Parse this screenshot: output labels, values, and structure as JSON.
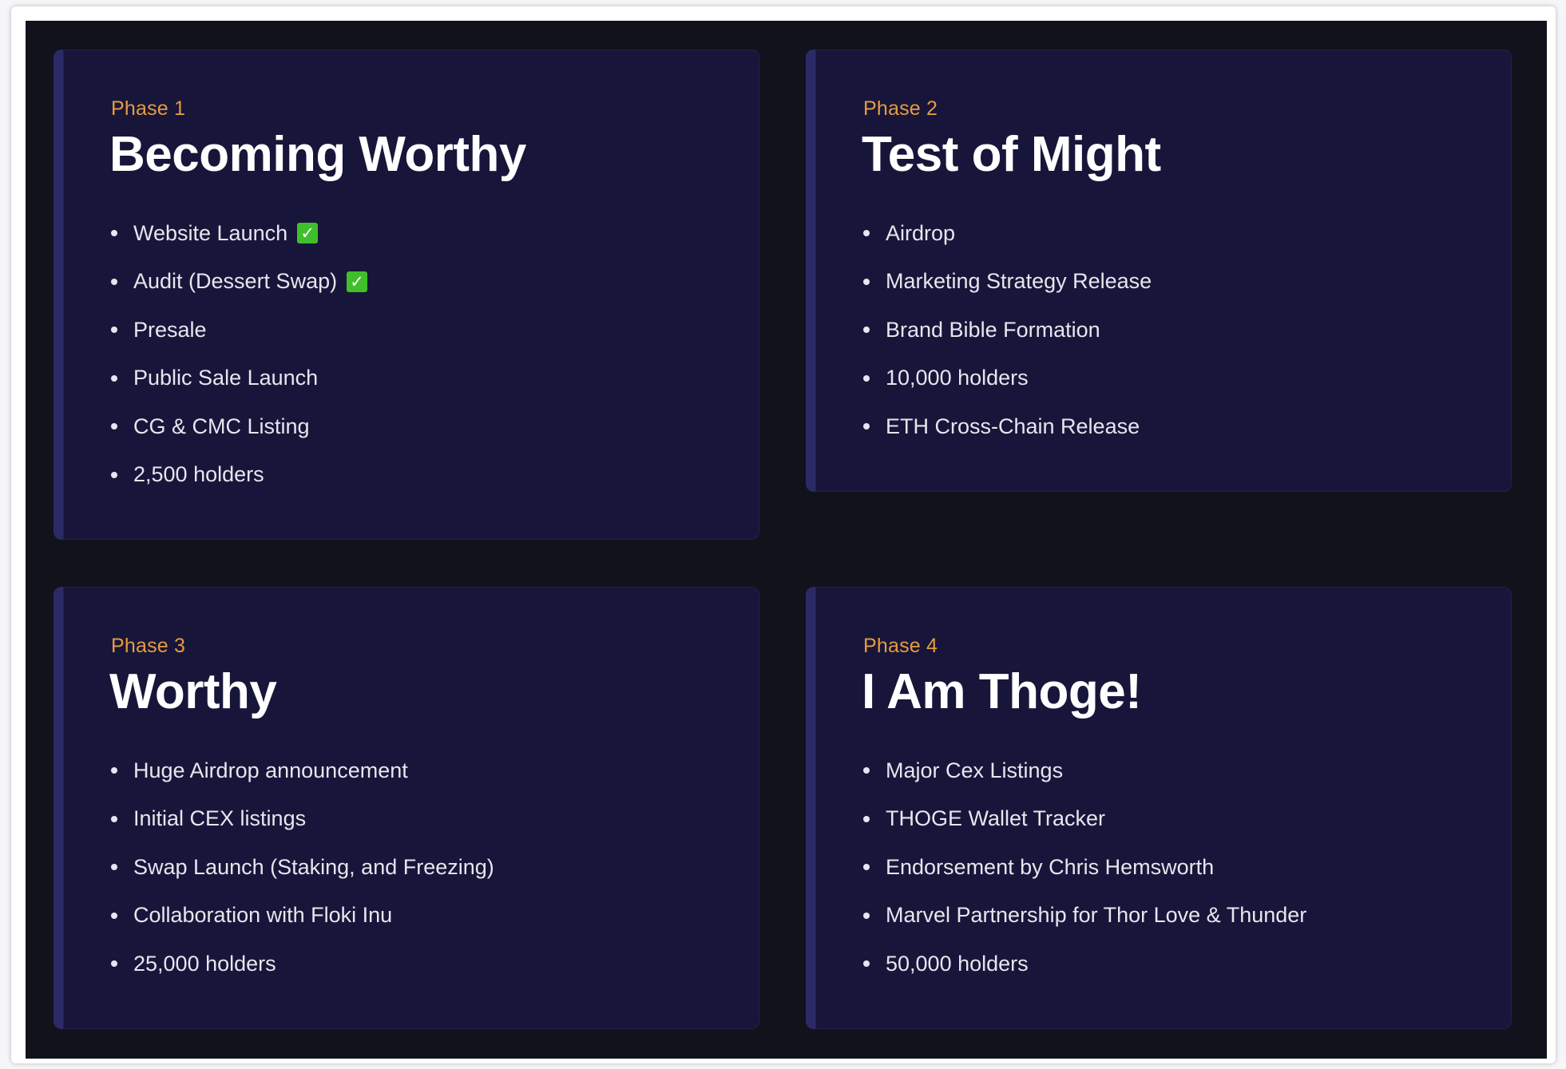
{
  "phases": [
    {
      "label": "Phase 1",
      "title": "Becoming Worthy",
      "items": [
        {
          "text": "Website Launch",
          "done": true
        },
        {
          "text": "Audit (Dessert Swap)",
          "done": true
        },
        {
          "text": "Presale",
          "done": false
        },
        {
          "text": "Public Sale Launch",
          "done": false
        },
        {
          "text": "CG & CMC Listing",
          "done": false
        },
        {
          "text": "2,500 holders",
          "done": false
        }
      ]
    },
    {
      "label": "Phase 2",
      "title": "Test of Might",
      "items": [
        {
          "text": "Airdrop",
          "done": false
        },
        {
          "text": "Marketing Strategy Release",
          "done": false
        },
        {
          "text": "Brand Bible Formation",
          "done": false
        },
        {
          "text": "10,000 holders",
          "done": false
        },
        {
          "text": "ETH Cross-Chain Release",
          "done": false
        }
      ]
    },
    {
      "label": "Phase 3",
      "title": "Worthy",
      "items": [
        {
          "text": "Huge Airdrop announcement",
          "done": false
        },
        {
          "text": "Initial CEX listings",
          "done": false
        },
        {
          "text": "Swap Launch (Staking, and Freezing)",
          "done": false
        },
        {
          "text": "Collaboration with Floki Inu",
          "done": false
        },
        {
          "text": "25,000 holders",
          "done": false
        }
      ]
    },
    {
      "label": "Phase 4",
      "title": "I Am Thoge!",
      "items": [
        {
          "text": "Major Cex Listings",
          "done": false
        },
        {
          "text": "THOGE Wallet Tracker",
          "done": false
        },
        {
          "text": "Endorsement by Chris Hemsworth",
          "done": false
        },
        {
          "text": "Marvel Partnership for Thor Love & Thunder",
          "done": false
        },
        {
          "text": "50,000 holders",
          "done": false
        }
      ]
    }
  ],
  "check_glyph": "✓",
  "colors": {
    "background": "#12121d",
    "card": "#17163a",
    "card_accent": "#2c2a66",
    "phase_label": "#e89a3e",
    "title": "#ffffff",
    "item_text": "#e6e6ee",
    "check": "#3fbf2b"
  },
  "icons": {
    "done": "check-mark-icon",
    "bullet": "bullet-icon"
  }
}
